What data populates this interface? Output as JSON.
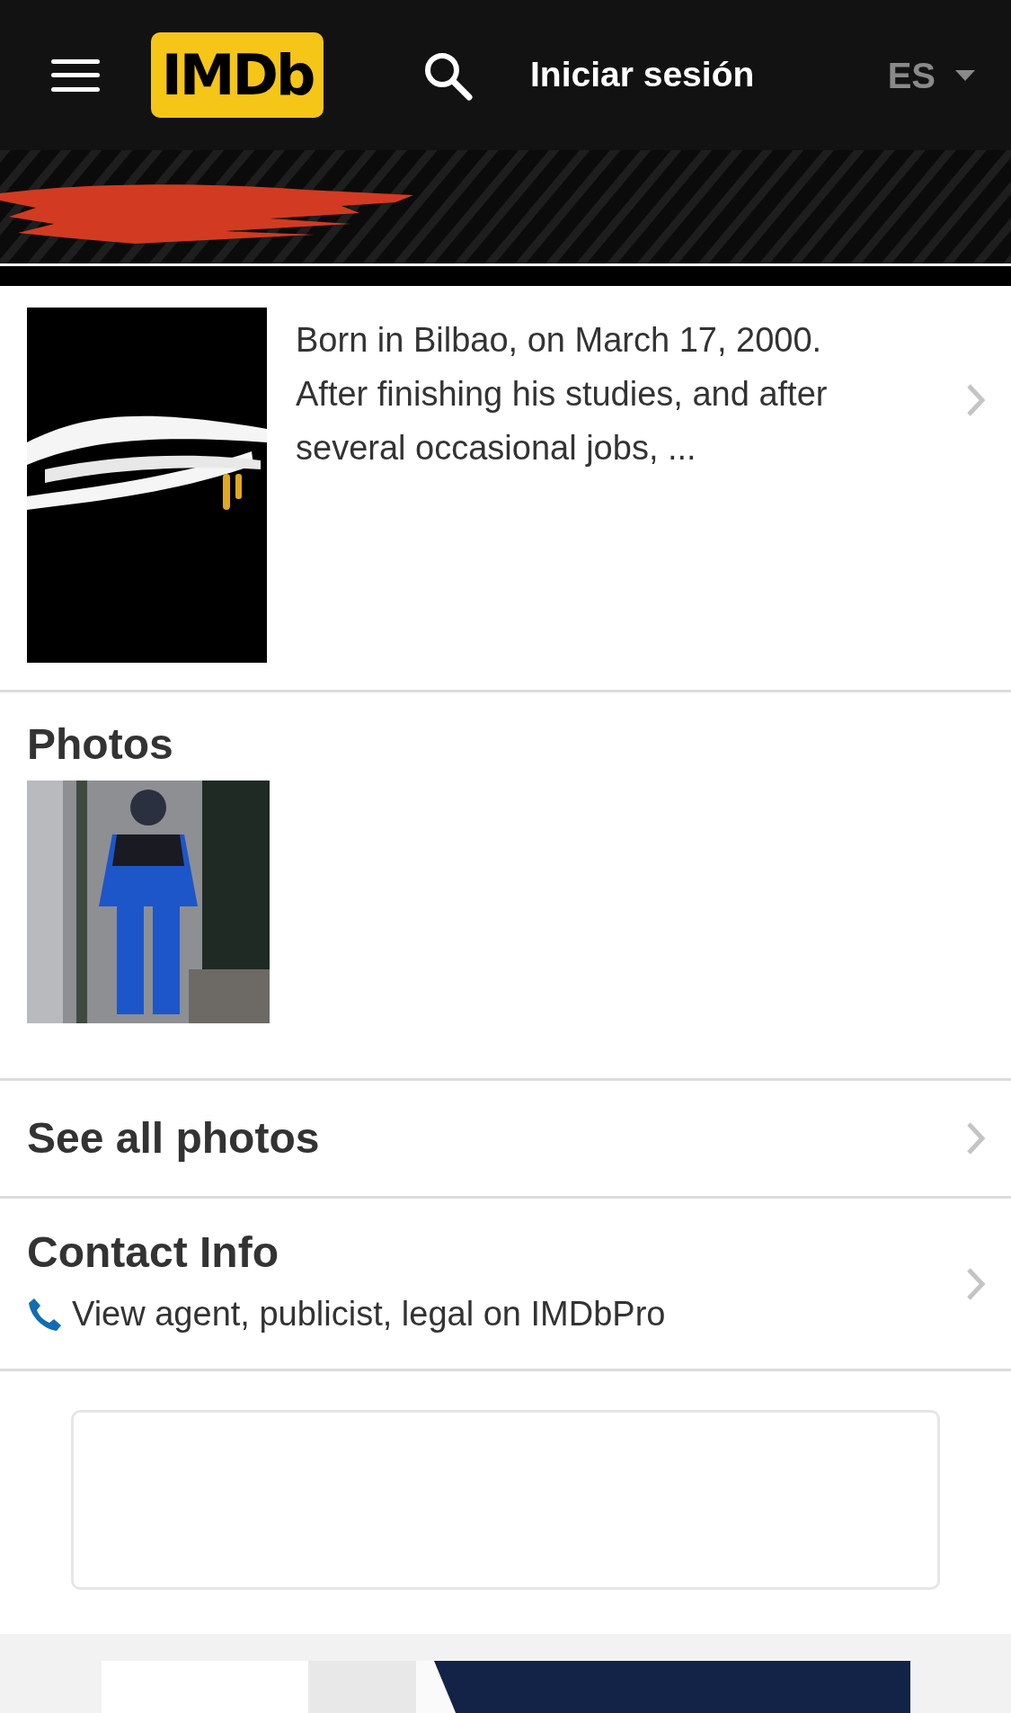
{
  "header": {
    "logo": "IMDb",
    "sign_in": "Iniciar sesión",
    "language": "ES"
  },
  "title_band": {
    "redacted": true
  },
  "bio": {
    "text": "Born in Bilbao, on March 17, 2000. After finishing his studies, and after several occasional jobs, ..."
  },
  "photos": {
    "heading": "Photos"
  },
  "see_all": {
    "label": "See all photos"
  },
  "contact": {
    "heading": "Contact Info",
    "link": "View agent, publicist, legal on IMDbPro"
  }
}
